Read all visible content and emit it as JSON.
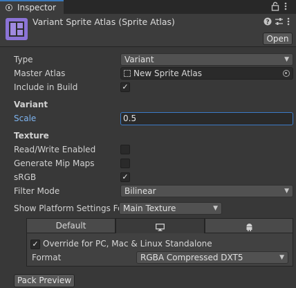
{
  "window": {
    "tab_title": "Inspector",
    "tab_icon": "info-icon",
    "toolbar_icons": [
      "lock-icon",
      "kebab-menu-icon"
    ]
  },
  "header": {
    "asset_icon": "sprite-atlas-icon",
    "title": "Variant Sprite Atlas (Sprite Atlas)",
    "header_icons": [
      "help-icon",
      "preset-icon",
      "kebab-menu-icon"
    ],
    "open_label": "Open"
  },
  "fields": {
    "type_label": "Type",
    "type_value": "Variant",
    "master_label": "Master Atlas",
    "master_value": "New Sprite Atlas",
    "include_label": "Include in Build",
    "include_checked": true
  },
  "variant": {
    "heading": "Variant",
    "scale_label": "Scale",
    "scale_value": "0.5"
  },
  "texture": {
    "heading": "Texture",
    "rw_label": "Read/Write Enabled",
    "rw_checked": false,
    "mip_label": "Generate Mip Maps",
    "mip_checked": false,
    "srgb_label": "sRGB",
    "srgb_checked": true,
    "filter_label": "Filter Mode",
    "filter_value": "Bilinear"
  },
  "platform": {
    "label": "Show Platform Settings Fo",
    "value": "Main Texture",
    "tabs": [
      {
        "label": "Default",
        "icon": ""
      },
      {
        "label": "",
        "icon": "monitor-icon"
      },
      {
        "label": "",
        "icon": "android-icon"
      }
    ],
    "override_label": "Override for PC, Mac & Linux Standalone",
    "override_checked": true,
    "format_label": "Format",
    "format_value": "RGBA Compressed DXT5"
  },
  "footer": {
    "pack_preview_label": "Pack Preview"
  },
  "colors": {
    "accent": "#3a79bb",
    "atlas_icon": "#8b73d6",
    "background": "#383838"
  }
}
